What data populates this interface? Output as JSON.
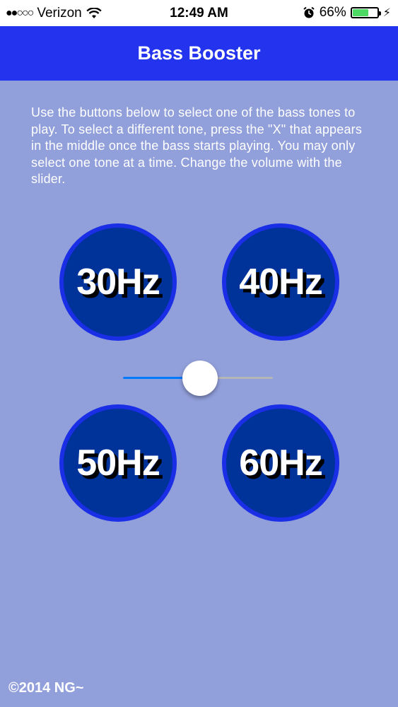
{
  "status_bar": {
    "signal_dots": "●●○○○",
    "carrier": "Verizon",
    "time": "12:49 AM",
    "battery_percent": "66%",
    "battery_level": 0.66,
    "icons": [
      "signal-dots-icon",
      "wifi-icon",
      "alarm-icon",
      "battery-icon",
      "charging-bolt-icon"
    ]
  },
  "nav": {
    "title": "Bass Booster"
  },
  "instructions": "Use the buttons below to select one of the bass tones to play. To select a different tone, press the \"X\" that appears in the middle once the bass starts playing. You may only select one tone at a time. Change the volume with the slider.",
  "tones": [
    {
      "label": "30Hz"
    },
    {
      "label": "40Hz"
    },
    {
      "label": "50Hz"
    },
    {
      "label": "60Hz"
    }
  ],
  "volume": {
    "value": 0.5
  },
  "footer": {
    "text": "©2014 NG~"
  },
  "colors": {
    "background": "#919fdb",
    "nav": "#2333ee",
    "tone_fill": "#003399",
    "tone_ring": "#1a2ee6",
    "slider_active": "#007aff",
    "battery": "#4cd964"
  }
}
